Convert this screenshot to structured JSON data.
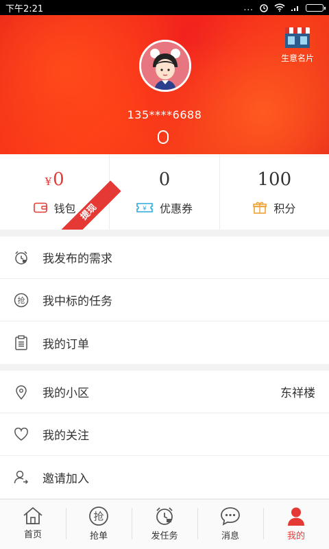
{
  "status_bar": {
    "time": "下午2:21",
    "signal_text": "..."
  },
  "header": {
    "card_label": "生意名片",
    "phone": "135****6688"
  },
  "stats": [
    {
      "id": "wallet",
      "currency": "¥",
      "value": "0",
      "label": "钱包",
      "ribbon": "提现",
      "icon": "wallet-icon",
      "color": "#e53935"
    },
    {
      "id": "coupon",
      "value": "0",
      "label": "优惠券",
      "icon": "coupon-icon",
      "color": "#29a8e0"
    },
    {
      "id": "points",
      "value": "100",
      "label": "积分",
      "icon": "gift-icon",
      "color": "#f0a030"
    }
  ],
  "menu_group_1": [
    {
      "label": "我发布的需求",
      "icon": "alarm-clock-icon"
    },
    {
      "label": "我中标的任务",
      "icon": "grab-order-icon"
    },
    {
      "label": "我的订单",
      "icon": "clipboard-icon"
    }
  ],
  "menu_group_2": [
    {
      "label": "我的小区",
      "icon": "location-pin-icon",
      "extra": "东祥楼"
    },
    {
      "label": "我的关注",
      "icon": "heart-icon"
    },
    {
      "label": "邀请加入",
      "icon": "invite-user-icon"
    }
  ],
  "tabbar": [
    {
      "label": "首页",
      "icon": "home-icon"
    },
    {
      "label": "抢单",
      "icon": "grab-order-icon",
      "glyph": "抢"
    },
    {
      "label": "发任务",
      "icon": "alarm-clock-icon"
    },
    {
      "label": "消息",
      "icon": "message-icon"
    },
    {
      "label": "我的",
      "icon": "user-icon",
      "active": true
    }
  ],
  "colors": {
    "accent": "#e53935",
    "header_red": "#f2321a"
  }
}
